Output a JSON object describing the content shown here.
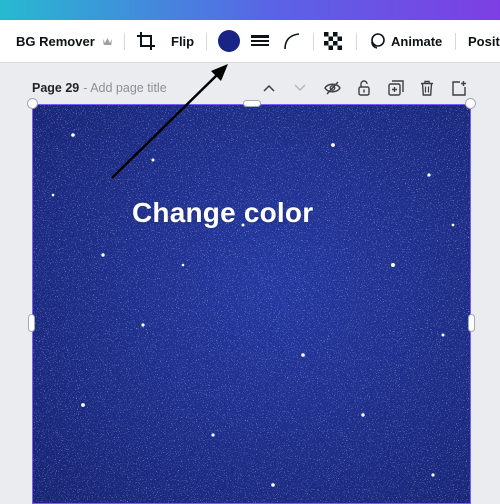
{
  "toolbar": {
    "bg_remover_label": "BG Remover",
    "flip_label": "Flip",
    "color_value": "#1a2486",
    "animate_label": "Animate",
    "position_label": "Positi"
  },
  "page": {
    "page_label": "Page 29",
    "title_placeholder": "- Add page title"
  },
  "annotation": {
    "text": "Change color"
  },
  "colors": {
    "glitter_base": "#1e2f9a",
    "frame_border": "#7d5cf7",
    "arrow": "#000000"
  },
  "icons": [
    "crown-icon",
    "crop-icon",
    "color-swatch",
    "border-style-icon",
    "corner-rounding-icon",
    "transparency-icon",
    "animate-icon",
    "chevron-up-icon",
    "chevron-down-icon",
    "hide-eye-icon",
    "unlock-icon",
    "duplicate-icon",
    "trash-icon",
    "add-page-icon"
  ]
}
